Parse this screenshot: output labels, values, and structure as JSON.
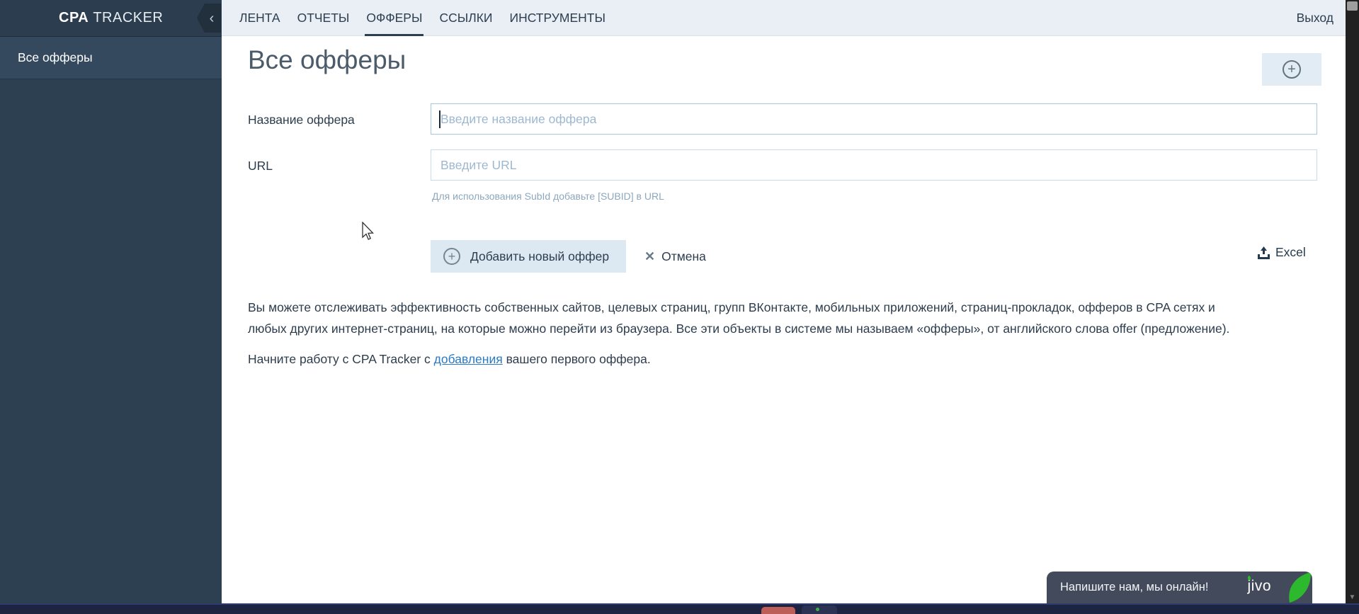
{
  "brand": {
    "logo_primary": "CPA",
    "logo_secondary": "TRACKER"
  },
  "topnav": {
    "tabs": [
      "ЛЕНТА",
      "ОТЧЕТЫ",
      "ОФФЕРЫ",
      "ССЫЛКИ",
      "ИНСТРУМЕНТЫ"
    ],
    "active_tab": "ОФФЕРЫ",
    "logout_label": "Выход"
  },
  "sidebar": {
    "items": [
      {
        "label": "Все офферы",
        "selected": true
      }
    ]
  },
  "main": {
    "title": "Все офферы",
    "form": {
      "name_label": "Название оффера",
      "name_value": "",
      "name_placeholder": "Введите название оффера",
      "url_label": "URL",
      "url_value": "",
      "url_placeholder": "Введите URL",
      "subid_hint": "Для использования SubId добавьте [SUBID] в URL",
      "submit_label": "Добавить новый оффер",
      "cancel_label": "Отмена",
      "excel_label": "Excel"
    },
    "intro_line1": "Вы можете отслеживать эффективность собственных сайтов, целевых страниц, групп ВКонтакте, мобильных приложений, страниц-прокладок, офферов в CPA сетях и",
    "intro_line2": "любых других интернет-страниц, на которые можно перейти из браузера. Все эти объекты в системе мы называем «офферы», от английского слова offer (предложение).",
    "start_prefix": "Начните работу с CPA Tracker с ",
    "start_link": "добавления",
    "start_suffix": " вашего первого оффера."
  },
  "chat_widget": {
    "message": "Напишите нам, мы онлайн!",
    "brand": "jivo"
  },
  "icons": {
    "plus": "+",
    "close": "✕",
    "chevron_left": "‹",
    "scroll_down": "▼"
  },
  "colors": {
    "sidebar_bg": "#2c4052",
    "sidebar_header_bg": "#2b3d4f",
    "sidebar_selected_bg": "#35495e",
    "topbar_bg": "#e9eff5",
    "nav_text": "#2c3e50",
    "button_bg": "#dde9f2",
    "link_blue": "#2a7ac6",
    "placeholder": "#9db8d0",
    "leaf_green": "#2db92d",
    "chat_bg": "#434a5c",
    "bottom_bar_bg": "#1d2442"
  }
}
